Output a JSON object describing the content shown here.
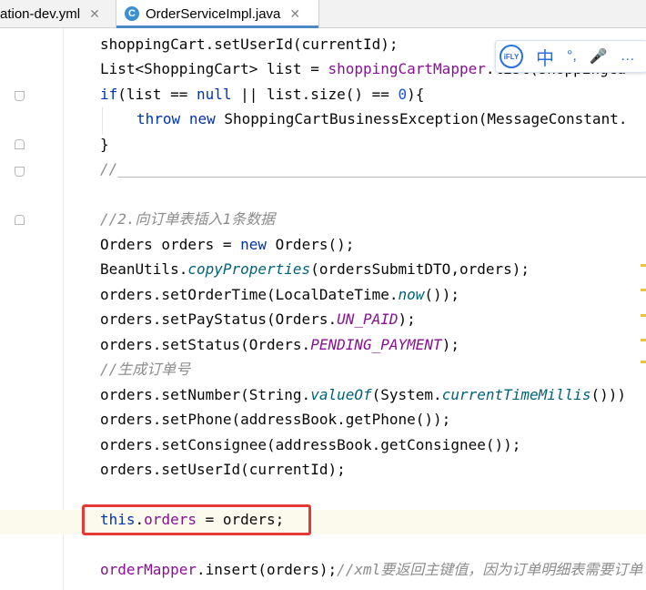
{
  "tabs": [
    {
      "label": "ation-dev.yml",
      "close": "✕"
    },
    {
      "label": "OrderServiceImpl.java",
      "icon": "C",
      "close": "✕"
    }
  ],
  "ime_toolbar": {
    "logo": "iFLY",
    "lang": "中",
    "punct": "°,",
    "mic": "🎤",
    "more": "…"
  },
  "code": {
    "l1": "shoppingCart.setUserId(currentId);",
    "l2a": "List<ShoppingCart> list = ",
    "l2b": "shoppingCartMapper",
    "l2c": ".list(shoppingCa",
    "l3a": "if",
    "l3b": "(list == ",
    "l3c": "null",
    "l3d": " || list.size() == ",
    "l3e": "0",
    "l3f": "){",
    "l4a": "throw",
    "l4b": " ",
    "l4c": "new",
    "l4d": " ShoppingCartBusinessException(MessageConstant.",
    "l5": "}",
    "l6": "//______________________________________________________________",
    "l7": "//2.向订单表插入1条数据",
    "l8a": "Orders orders = ",
    "l8b": "new",
    "l8c": " Orders();",
    "l9a": "BeanUtils.",
    "l9b": "copyProperties",
    "l9c": "(ordersSubmitDTO,orders);",
    "l10a": "orders.setOrderTime(LocalDateTime.",
    "l10b": "now",
    "l10c": "());",
    "l11a": "orders.setPayStatus(Orders.",
    "l11b": "UN_PAID",
    "l11c": ");",
    "l12a": "orders.setStatus(Orders.",
    "l12b": "PENDING_PAYMENT",
    "l12c": ");",
    "l13": "//生成订单号",
    "l14a": "orders.setNumber(String.",
    "l14b": "valueOf",
    "l14c": "(System.",
    "l14d": "currentTimeMillis",
    "l14e": "()))",
    "l15": "orders.setPhone(addressBook.getPhone());",
    "l16": "orders.setConsignee(addressBook.getConsignee());",
    "l17": "orders.setUserId(currentId);",
    "l18a": "this",
    "l18b": ".",
    "l18c": "orders",
    "l18d": " = orders;",
    "l19a": "orderMapper",
    "l19b": ".insert(orders);",
    "l19c": "//xml要返回主键值，因为订单明细表需要订单"
  },
  "colors": {
    "keyword": "#0033b3",
    "field": "#871094",
    "comment": "#8c8c8c",
    "highlight_box": "#e53935"
  }
}
